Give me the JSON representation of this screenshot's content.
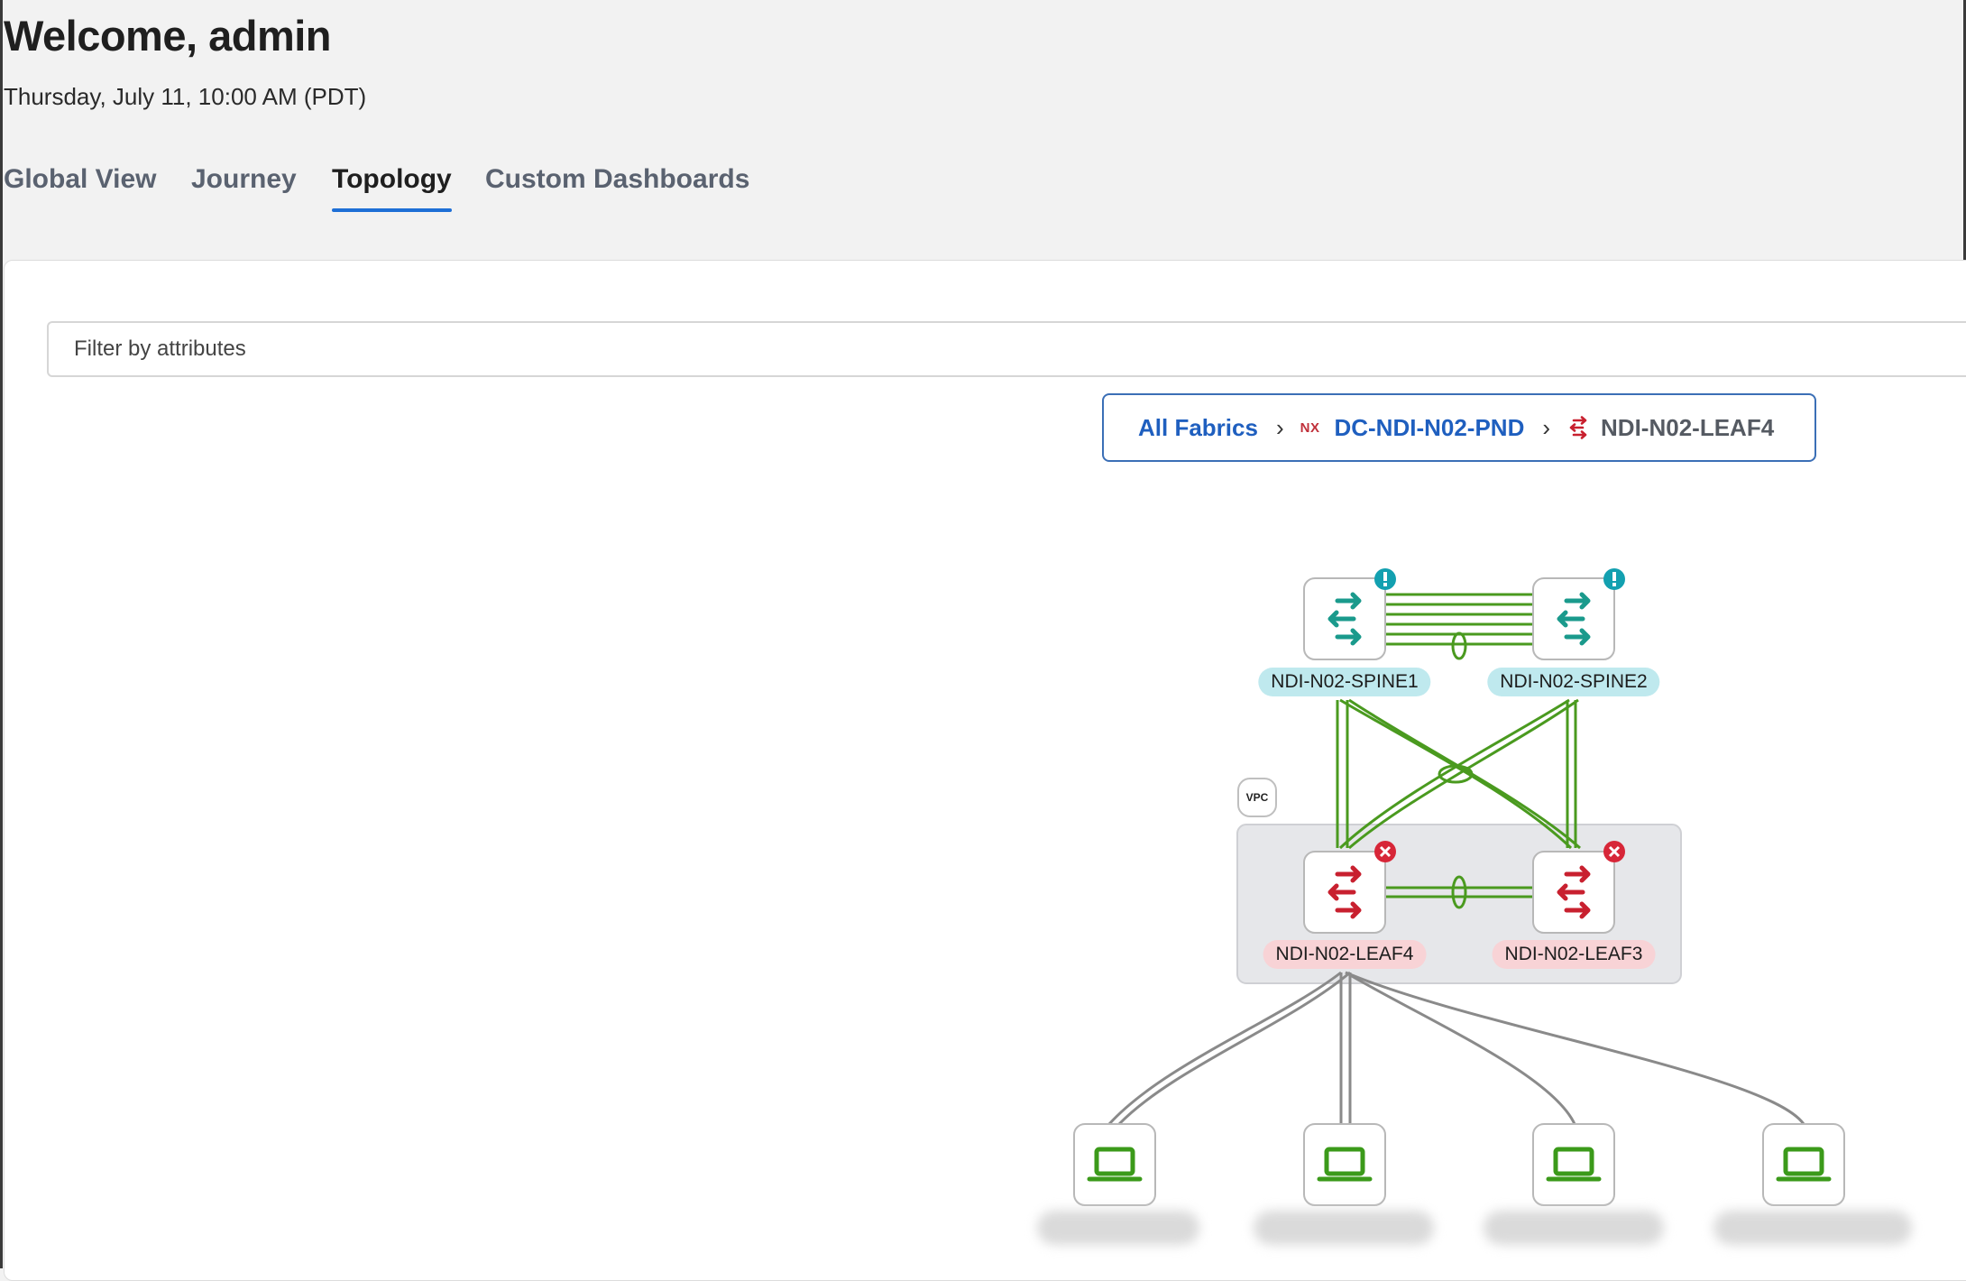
{
  "header": {
    "welcome": "Welcome, admin",
    "datetime": "Thursday, July 11, 10:00 AM (PDT)"
  },
  "tabs": [
    {
      "label": "Global View",
      "active": false
    },
    {
      "label": "Journey",
      "active": false
    },
    {
      "label": "Topology",
      "active": true
    },
    {
      "label": "Custom Dashboards",
      "active": false
    }
  ],
  "filter": {
    "placeholder": "Filter by attributes"
  },
  "breadcrumb": {
    "all_fabrics": "All Fabrics",
    "fabric_badge": "NX",
    "fabric": "DC-NDI-N02-PND",
    "current": "NDI-N02-LEAF4",
    "separator": "›"
  },
  "topology": {
    "spines": [
      {
        "name": "NDI-N02-SPINE1",
        "status": "warning"
      },
      {
        "name": "NDI-N02-SPINE2",
        "status": "warning"
      }
    ],
    "vpc_label": "VPC",
    "leaves": [
      {
        "name": "NDI-N02-LEAF4",
        "status": "critical"
      },
      {
        "name": "NDI-N02-LEAF3",
        "status": "critical"
      }
    ],
    "hosts_count": 4,
    "colors": {
      "spine_icon": "#1a9a8c",
      "leaf_icon": "#c8202f",
      "link_green": "#4a9a1f",
      "host_green": "#3b9a1a",
      "warning_badge": "#13a0b0",
      "critical_badge": "#d72638"
    }
  }
}
